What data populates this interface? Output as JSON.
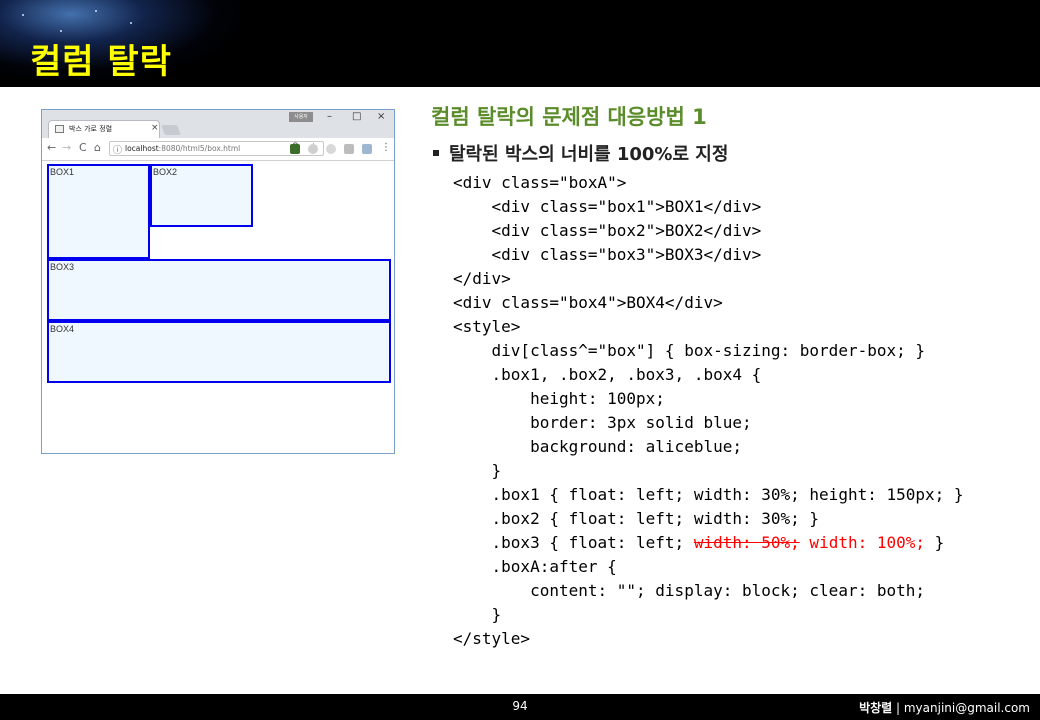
{
  "header": {
    "title": "컬럼 탈락"
  },
  "browser": {
    "tab_title": "박스 가로 정렬",
    "tab_close": "×",
    "user_badge": "사용자",
    "win_min": "–",
    "win_max": "□",
    "win_close": "×",
    "nav_back": "←",
    "nav_forward": "→",
    "nav_reload": "C",
    "nav_home": "⌂",
    "url_host": "localhost",
    "url_path": ":8080/html5/box.html",
    "menu": "⋮",
    "boxes": {
      "box1": "BOX1",
      "box2": "BOX2",
      "box3": "BOX3",
      "box4": "BOX4"
    }
  },
  "slide": {
    "heading": "컬럼 탈락의 문제점 대응방법 1",
    "bullet": "탈락된 박스의 너비를 100%로 지정"
  },
  "code": {
    "l1": "<div class=\"boxA\">",
    "l2": "    <div class=\"box1\">BOX1</div>",
    "l3": "    <div class=\"box2\">BOX2</div>",
    "l4": "    <div class=\"box3\">BOX3</div>",
    "l5": "</div>",
    "l6": "<div class=\"box4\">BOX4</div>",
    "l7": "<style>",
    "l8": "    div[class^=\"box\"] { box-sizing: border-box; }",
    "l9": "    .box1, .box2, .box3, .box4 {",
    "l10": "        height: 100px;",
    "l11": "        border: 3px solid blue;",
    "l12": "        background: aliceblue;",
    "l13": "    }",
    "l14": "    .box1 { float: left; width: 30%; height: 150px; }",
    "l15": "    .box2 { float: left; width: 30%; }",
    "l16_pre": "    .box3 { float: left; ",
    "l16_strike": "width: 50%;",
    "l16_new": " width: 100%;",
    "l16_post": " }",
    "l17": "    .boxA:after {",
    "l18": "        content: \"\"; display: block; clear: both;",
    "l19": "    }",
    "l20": "</style>"
  },
  "footer": {
    "page": "94",
    "author": "박창렬",
    "separator": " | ",
    "email": "myanjini@gmail.com"
  },
  "colors": {
    "title": "#ffff00",
    "heading": "#5b8c2a",
    "box_border": "#0000ee",
    "box_bg": "#f0f8ff",
    "strike": "#ff0000"
  }
}
